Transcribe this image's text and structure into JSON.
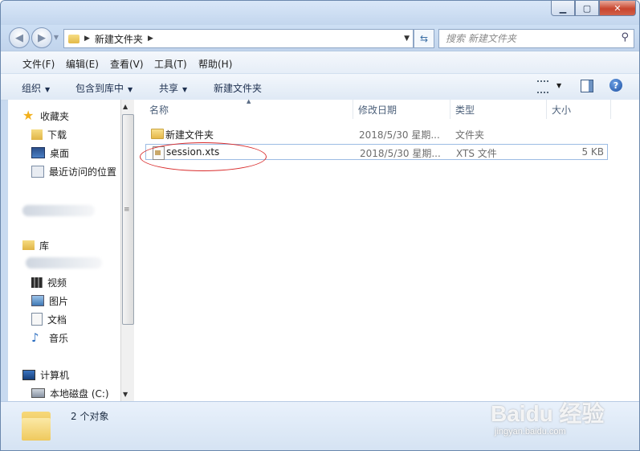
{
  "window": {
    "minimize_symbol": "▁",
    "maximize_symbol": "▢",
    "close_symbol": "✕"
  },
  "address": {
    "crumb": "新建文件夹",
    "search_placeholder": "搜索 新建文件夹"
  },
  "menu": [
    "文件(F)",
    "编辑(E)",
    "查看(V)",
    "工具(T)",
    "帮助(H)"
  ],
  "toolbar": {
    "organize": "组织",
    "include_in_library": "包含到库中",
    "share": "共享",
    "new_folder": "新建文件夹"
  },
  "sidebar": {
    "favorites": "收藏夹",
    "downloads": "下载",
    "desktop": "桌面",
    "recent": "最近访问的位置",
    "libraries": "库",
    "videos": "视频",
    "pictures": "图片",
    "documents": "文档",
    "music": "音乐",
    "computer": "计算机",
    "local_disk": "本地磁盘 (C:)"
  },
  "columns": {
    "name": "名称",
    "date": "修改日期",
    "type": "类型",
    "size": "大小"
  },
  "files": [
    {
      "name": "新建文件夹",
      "date": "2018/5/30 星期...",
      "type": "文件夹",
      "size": "",
      "icon": "folder-icon"
    },
    {
      "name": "session.xts",
      "date": "2018/5/30 星期...",
      "type": "XTS 文件",
      "size": "5 KB",
      "icon": "file-icon"
    }
  ],
  "details": {
    "count": "2 个对象"
  },
  "watermark": {
    "brand": "Baidu 经验",
    "url": "jingyan.baidu.com"
  },
  "colors": {
    "accent": "#3a6ea5",
    "annotation": "#d92b2b"
  }
}
